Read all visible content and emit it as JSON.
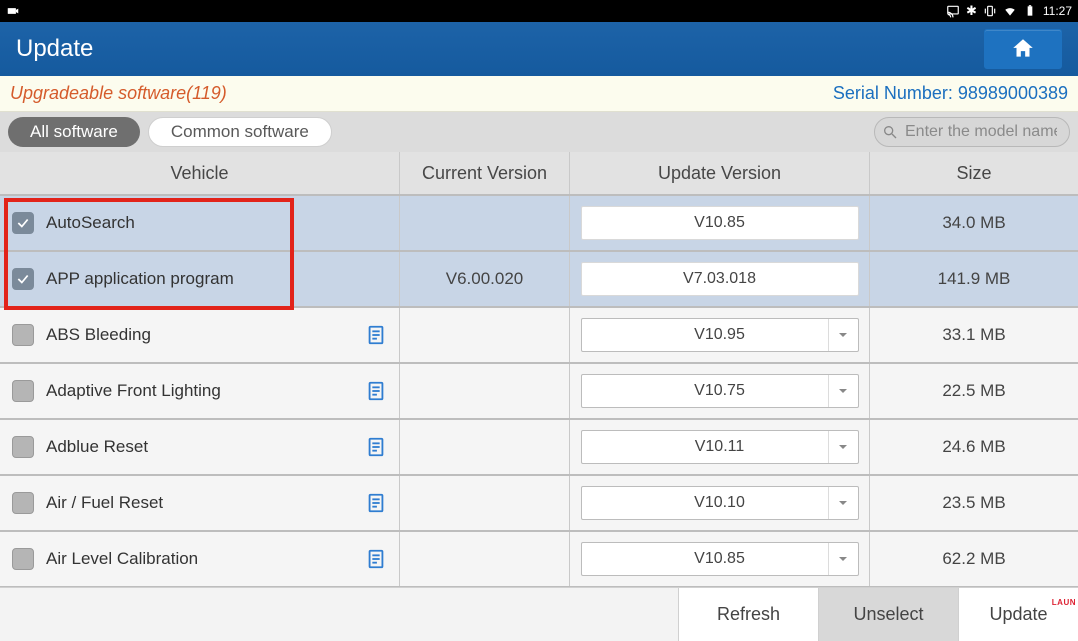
{
  "statusbar": {
    "time": "11:27"
  },
  "titlebar": {
    "title": "Update"
  },
  "notice": {
    "upgradeable": "Upgradeable software(119)",
    "serial_label": "Serial Number:  ",
    "serial_value": "98989000389"
  },
  "filter": {
    "all": "All software",
    "common": "Common software",
    "search_placeholder": "Enter the model name"
  },
  "headers": {
    "vehicle": "Vehicle",
    "curver": "Current Version",
    "updver": "Update Version",
    "size": "Size"
  },
  "rows": [
    {
      "checked": true,
      "name": "AutoSearch",
      "curver": "",
      "updver": "V10.85",
      "size": "34.0 MB",
      "highlight": true,
      "dropdown": false,
      "doc": false
    },
    {
      "checked": true,
      "name": "APP application program",
      "curver": "V6.00.020",
      "updver": "V7.03.018",
      "size": "141.9 MB",
      "highlight": true,
      "dropdown": false,
      "doc": false
    },
    {
      "checked": false,
      "name": "ABS Bleeding",
      "curver": "",
      "updver": "V10.95",
      "size": "33.1 MB",
      "highlight": false,
      "dropdown": true,
      "doc": true
    },
    {
      "checked": false,
      "name": "Adaptive Front Lighting",
      "curver": "",
      "updver": "V10.75",
      "size": "22.5 MB",
      "highlight": false,
      "dropdown": true,
      "doc": true
    },
    {
      "checked": false,
      "name": "Adblue Reset",
      "curver": "",
      "updver": "V10.11",
      "size": "24.6 MB",
      "highlight": false,
      "dropdown": true,
      "doc": true
    },
    {
      "checked": false,
      "name": "Air / Fuel Reset",
      "curver": "",
      "updver": "V10.10",
      "size": "23.5 MB",
      "highlight": false,
      "dropdown": true,
      "doc": true
    },
    {
      "checked": false,
      "name": "Air Level Calibration",
      "curver": "",
      "updver": "V10.85",
      "size": "62.2 MB",
      "highlight": false,
      "dropdown": true,
      "doc": true
    }
  ],
  "bottom": {
    "refresh": "Refresh",
    "unselect": "Unselect",
    "update": "Update",
    "launch": "LAUN"
  }
}
